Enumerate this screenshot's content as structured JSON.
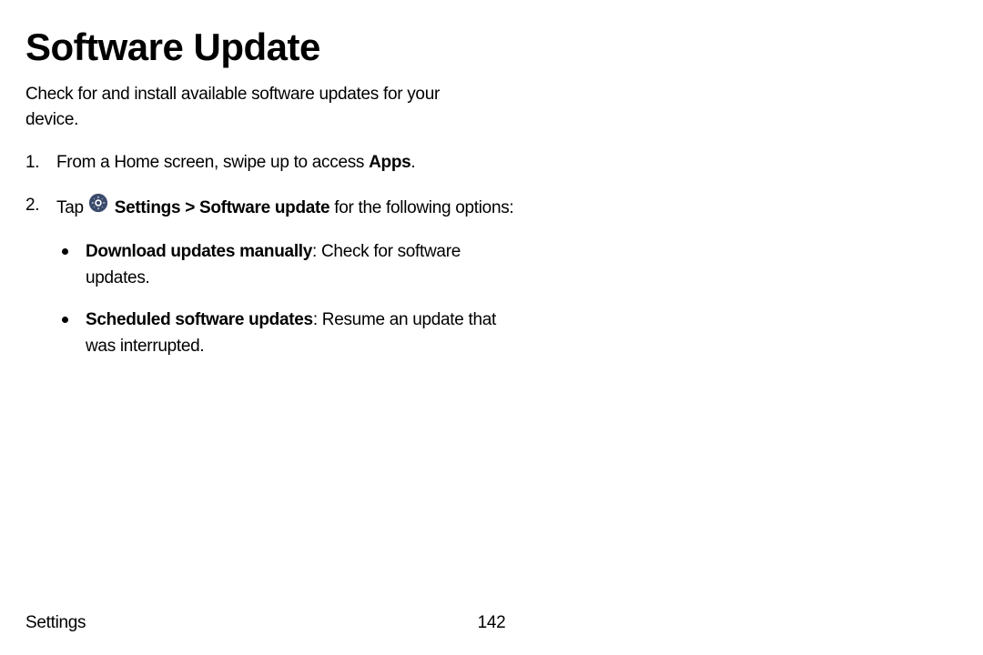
{
  "title": "Software Update",
  "intro": "Check for and install available software updates for your device.",
  "steps": [
    {
      "prefix": "From a Home screen, swipe up to access ",
      "bold": "Apps",
      "suffix": "."
    },
    {
      "prefix": "Tap ",
      "iconLabel": "Settings",
      "breadcrumb": "Settings > Software update",
      "suffix": " for the following options:"
    }
  ],
  "bullets": [
    {
      "bold": "Download updates manually",
      "text": ": Check for software updates."
    },
    {
      "bold": "Scheduled software updates",
      "text": ": Resume an update that was interrupted."
    }
  ],
  "footer": {
    "section": "Settings",
    "page": "142"
  }
}
